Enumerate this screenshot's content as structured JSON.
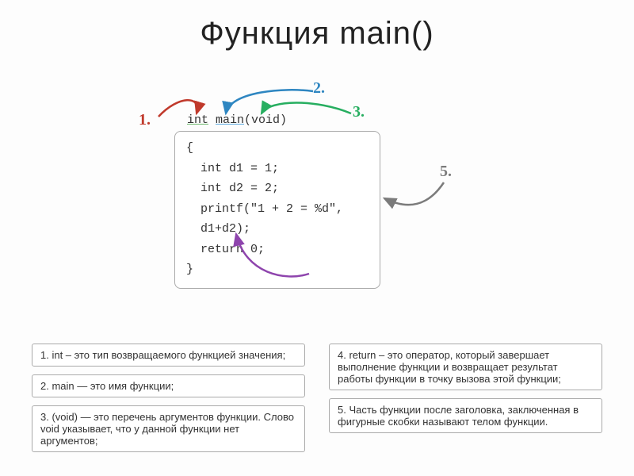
{
  "title": "Функция main()",
  "labels": {
    "l1": "1.",
    "l2": "2.",
    "l3": "3.",
    "l4": "4.",
    "l5": "5."
  },
  "code": {
    "sig_int": "int",
    "sig_main": "main",
    "sig_void": "(void)",
    "line_open": "{",
    "line1": "int d1 = 1;",
    "line2": "int d2 = 2;",
    "line3": "printf(\"1 + 2 = %d\", d1+d2);",
    "line4": "return 0;",
    "line_close": "}"
  },
  "descriptions": {
    "d1": "1.  int – это тип возвращаемого функцией значения;",
    "d2": "2.  main — это имя функции;",
    "d3": "3.  (void) — это перечень аргументов функции. Слово void указывает, что у данной функции нет аргументов;",
    "d4": "4.  return – это оператор, который завершает выполнение функции и возвращает результат работы функции в точку вызова этой функции;",
    "d5": "5.  Часть функции после заголовка, заключенная в фигурные скобки называют телом функции."
  }
}
